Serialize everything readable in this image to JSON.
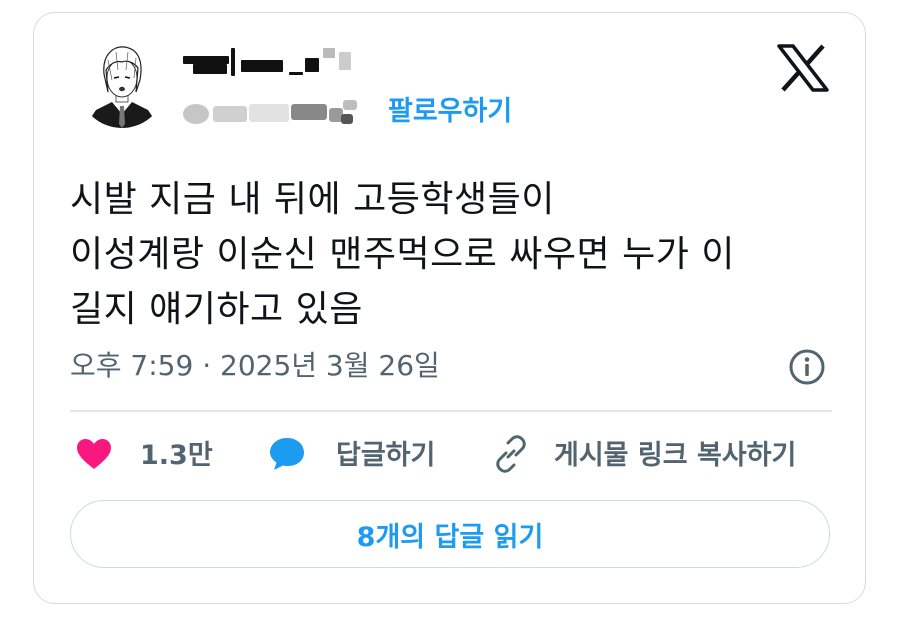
{
  "tweet": {
    "follow_label": "팔로우하기",
    "text": "시발 지금 내 뒤에 고등학생들이\n이성계랑 이순신 맨주먹으로 싸우면 누가 이\n길지 얘기하고 있음",
    "timestamp": "오후 7:59 · 2025년 3월 26일"
  },
  "actions": {
    "like_count": "1.3만",
    "reply_label": "답글하기",
    "copy_link_label": "게시물 링크 복사하기"
  },
  "read_replies_label": "8개의 답글 읽기",
  "colors": {
    "accent": "#1d9bf0",
    "like": "#f91880",
    "text": "#0f1419",
    "muted": "#536471",
    "border": "#d5dbe0"
  },
  "icons": [
    "x-logo-icon",
    "info-icon",
    "heart-icon",
    "reply-bubble-icon",
    "link-icon"
  ]
}
